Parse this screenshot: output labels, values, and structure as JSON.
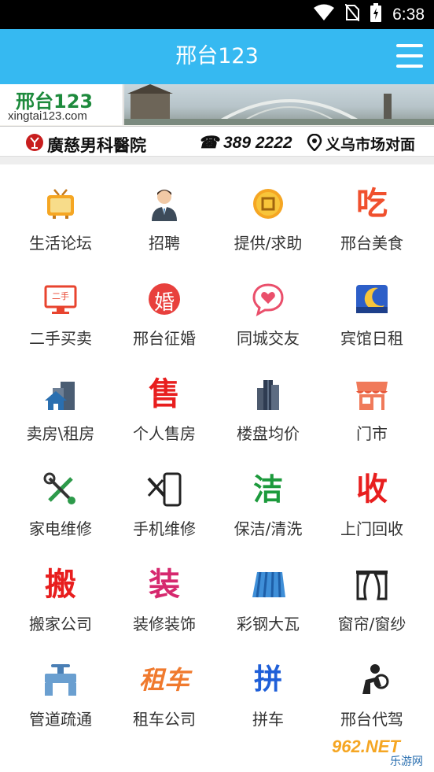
{
  "status_bar": {
    "time": "6:38"
  },
  "app_bar": {
    "title": "邢台123"
  },
  "banner": {
    "logo_main": "邢台123",
    "logo_sub": "xingtai123.com",
    "hospital": "廣慈男科醫院",
    "phone": "☎ 389 2222",
    "address": "义乌市场对面"
  },
  "grid": {
    "items": [
      {
        "label": "生活论坛",
        "icon": "tv-icon"
      },
      {
        "label": "招聘",
        "icon": "person-icon"
      },
      {
        "label": "提供/求助",
        "icon": "coin-icon"
      },
      {
        "label": "邢台美食",
        "icon": "eat-icon"
      },
      {
        "label": "二手买卖",
        "icon": "monitor-icon"
      },
      {
        "label": "邢台征婚",
        "icon": "marriage-icon"
      },
      {
        "label": "同城交友",
        "icon": "heart-chat-icon"
      },
      {
        "label": "宾馆日租",
        "icon": "moon-bed-icon"
      },
      {
        "label": "卖房\\租房",
        "icon": "house-icon"
      },
      {
        "label": "个人售房",
        "icon": "sell-icon"
      },
      {
        "label": "楼盘均价",
        "icon": "building-icon"
      },
      {
        "label": "门市",
        "icon": "shop-icon"
      },
      {
        "label": "家电维修",
        "icon": "tools-icon"
      },
      {
        "label": "手机维修",
        "icon": "phone-repair-icon"
      },
      {
        "label": "保洁/清洗",
        "icon": "clean-icon"
      },
      {
        "label": "上门回收",
        "icon": "recycle-icon"
      },
      {
        "label": "搬家公司",
        "icon": "moving-icon"
      },
      {
        "label": "装修装饰",
        "icon": "decoration-icon"
      },
      {
        "label": "彩钢大瓦",
        "icon": "steel-tile-icon"
      },
      {
        "label": "窗帘/窗纱",
        "icon": "curtain-icon"
      },
      {
        "label": "管道疏通",
        "icon": "pipe-icon"
      },
      {
        "label": "租车公司",
        "icon": "car-rental-icon"
      },
      {
        "label": "拼车",
        "icon": "carpool-icon"
      },
      {
        "label": "邢台代驾",
        "icon": "driver-icon"
      }
    ],
    "glyphs": {
      "eat": "吃",
      "marriage": "婚",
      "sell": "售",
      "clean": "洁",
      "recycle": "收",
      "moving": "搬",
      "decoration": "装",
      "carpool": "拼",
      "car_rental": "租车",
      "monitor": "二手"
    }
  },
  "watermark": {
    "text": "962.NET",
    "sub": "乐游网"
  }
}
